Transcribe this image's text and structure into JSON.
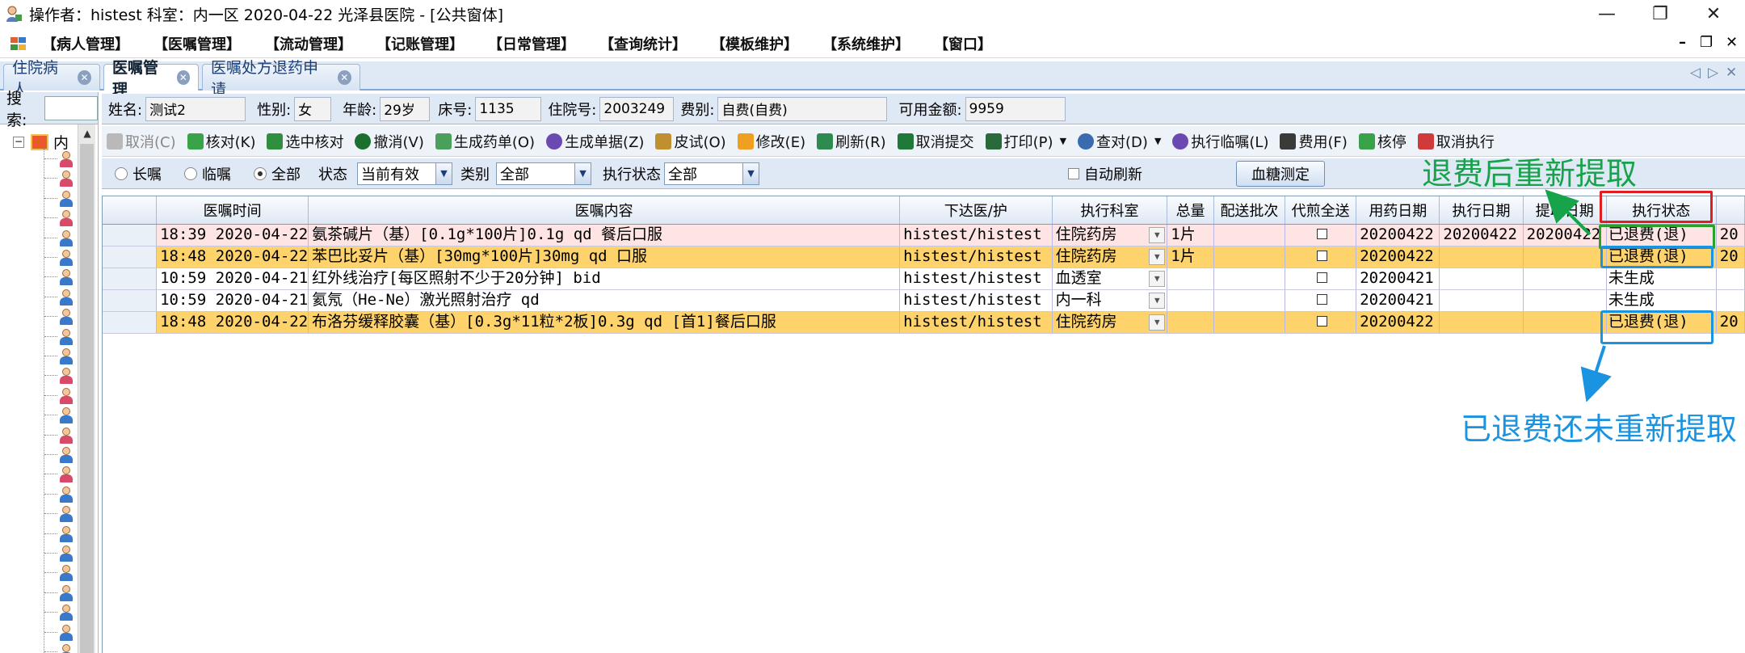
{
  "window": {
    "title": "操作者：histest  科室：内一区  2020-04-22  光泽县医院 - [公共窗体]",
    "minimize": "—",
    "restore": "❐",
    "close": "✕"
  },
  "menu": {
    "items": [
      "【病人管理】",
      "【医嘱管理】",
      "【流动管理】",
      "【记账管理】",
      "【日常管理】",
      "【查询统计】",
      "【模板维护】",
      "【系统维护】",
      "【窗口】"
    ],
    "mdi_minimize": "–",
    "mdi_restore": "❐",
    "mdi_close": "✕"
  },
  "tabs": [
    {
      "label": "住院病人",
      "active": false
    },
    {
      "label": "医嘱管理",
      "active": true
    },
    {
      "label": "医嘱处方退药申请",
      "active": false
    }
  ],
  "tab_nav": {
    "prev": "◁",
    "next": "▷",
    "close": "✕"
  },
  "sidebar": {
    "search_label": "搜索:",
    "search_value": "",
    "root_label": "内",
    "expand": "−",
    "scroll_up": "▲"
  },
  "patient_info": {
    "name_label": "姓名:",
    "name": "测试2",
    "sex_label": "性别:",
    "sex": "女",
    "age_label": "年龄:",
    "age": "29岁",
    "bed_label": "床号:",
    "bed": "1135",
    "admission_label": "住院号:",
    "admission": "2003249",
    "fee_type_label": "费别:",
    "fee_type": "自费(自费)",
    "balance_label": "可用金额:",
    "balance": "9959"
  },
  "toolbar": {
    "buttons": [
      {
        "label": "取消(C)",
        "disabled": true
      },
      {
        "label": "核对(K)"
      },
      {
        "label": "选中核对"
      },
      {
        "label": "撤消(V)"
      },
      {
        "label": "生成药单(O)"
      },
      {
        "label": "生成单据(Z)"
      },
      {
        "label": "皮试(O)"
      },
      {
        "label": "修改(E)"
      },
      {
        "label": "刷新(R)"
      },
      {
        "label": "取消提交"
      },
      {
        "label": "打印(P)"
      },
      {
        "label": "查对(D)"
      },
      {
        "label": "执行临嘱(L)"
      },
      {
        "label": "费用(F)"
      },
      {
        "label": "核停"
      },
      {
        "label": "取消执行"
      }
    ]
  },
  "filters": {
    "long_term": "长嘱",
    "temporary": "临嘱",
    "all": "全部",
    "status_label": "状态",
    "status_value": "当前有效",
    "category_label": "类别",
    "category_value": "全部",
    "exec_status_label": "执行状态",
    "exec_status_value": "全部",
    "auto_refresh": "自动刷新",
    "glucose_button": "血糖测定"
  },
  "table": {
    "columns": [
      "医嘱时间",
      "医嘱内容",
      "下达医/护",
      "执行科室",
      "总量",
      "配送批次",
      "代煎全送",
      "用药日期",
      "执行日期",
      "提取日期",
      "执行状态",
      ""
    ],
    "rows": [
      {
        "style": "pink",
        "time": "2020-04-22 18:39",
        "content": "氨茶碱片（基）[0.1g*100片]0.1g qd 餐后口服",
        "doctor": "histest/histest",
        "dept": "住院药房",
        "total": "1片",
        "batch": "",
        "decoct": "",
        "use_date": "20200422",
        "exec_date": "20200422",
        "extract_date": "20200422",
        "exec_status": "已退费(退)",
        "extra": "20"
      },
      {
        "style": "orange",
        "time": "2020-04-22 18:48",
        "content": "苯巴比妥片（基）[30mg*100片]30mg qd 口服",
        "doctor": "histest/histest",
        "dept": "住院药房",
        "total": "1片",
        "batch": "",
        "decoct": "",
        "use_date": "20200422",
        "exec_date": "",
        "extract_date": "",
        "exec_status": "已退费(退)",
        "extra": "20"
      },
      {
        "style": "white",
        "time": "2020-04-21 10:59",
        "content": "红外线治疗[每区照射不少于20分钟] bid",
        "doctor": "histest/histest",
        "dept": "血透室",
        "total": "",
        "batch": "",
        "decoct": "",
        "use_date": "20200421",
        "exec_date": "",
        "extract_date": "",
        "exec_status": "未生成",
        "extra": ""
      },
      {
        "style": "white",
        "time": "2020-04-21 10:59",
        "content": "氦氖（He-Ne）激光照射治疗 qd",
        "doctor": "histest/histest",
        "dept": "内一科",
        "total": "",
        "batch": "",
        "decoct": "",
        "use_date": "20200421",
        "exec_date": "",
        "extract_date": "",
        "exec_status": "未生成",
        "extra": ""
      },
      {
        "style": "orange",
        "time": "2020-04-22 18:48",
        "content": "布洛芬缓释胶囊（基）[0.3g*11粒*2板]0.3g qd [首1]餐后口服",
        "doctor": "histest/histest",
        "dept": "住院药房",
        "total": "",
        "batch": "",
        "decoct": "",
        "use_date": "20200422",
        "exec_date": "",
        "extract_date": "",
        "exec_status": "已退费(退)",
        "extra": "20"
      }
    ]
  },
  "annotations": {
    "green": "退费后重新提取",
    "blue": "已退费还未重新提取",
    "green_color": "#17a34a",
    "blue_color": "#1a93e0",
    "red_color": "#e02020"
  }
}
